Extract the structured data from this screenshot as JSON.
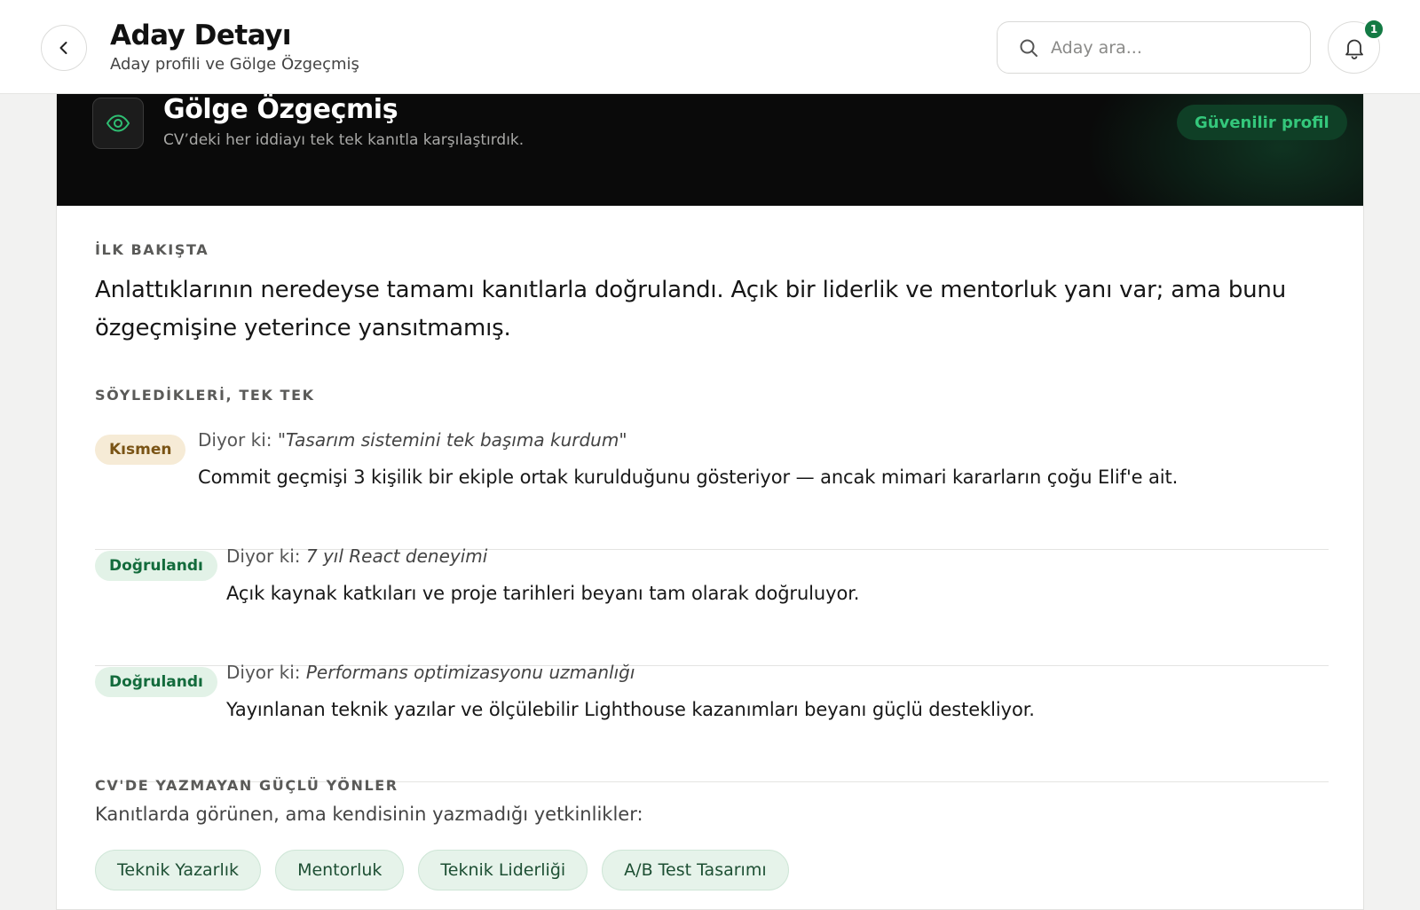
{
  "header": {
    "title": "Aday Detayı",
    "subtitle": "Aday profili ve Gölge Özgeçmiş",
    "search_placeholder": "Aday ara...",
    "notification_count": "1"
  },
  "shadow_cv": {
    "title": "Gölge Özgeçmiş",
    "subtitle": "CV’deki her iddiayı tek tek kanıtla karşılaştırdık.",
    "trust_label": "Güvenilir profil"
  },
  "overview": {
    "label": "İLK BAKIŞTA",
    "text": "Anlattıklarının neredeyse tamamı kanıtlarla doğrulandı. Açık bir liderlik ve mentorluk yanı var; ama bunu özgeçmişine yeterince yansıtmamış."
  },
  "claims": {
    "label": "SÖYLEDİKLERİ, TEK TEK",
    "items": [
      {
        "status": "Kısmen",
        "prefix": "Diyor ki:",
        "quote": "\"Tasarım sistemini tek başıma kurdum\"",
        "detail": "Commit geçmişi 3 kişilik bir ekiple ortak kurulduğunu gösteriyor — ancak mimari kararların çoğu Elif'e ait."
      },
      {
        "status": "Doğrulandı",
        "prefix": "Diyor ki:",
        "quote": "7 yıl React deneyimi",
        "detail": "Açık kaynak katkıları ve proje tarihleri beyanı tam olarak doğruluyor."
      },
      {
        "status": "Doğrulandı",
        "prefix": "Diyor ki:",
        "quote": "Performans optimizasyonu uzmanlığı",
        "detail": "Yayınlanan teknik yazılar ve ölçülebilir Lighthouse kazanımları beyanı güçlü destekliyor."
      }
    ]
  },
  "hidden_strengths": {
    "label": "CV'DE YAZMAYAN GÜÇLÜ YÖNLER",
    "intro": "Kanıtlarda görünen, ama kendisinin yazmadığı yetkinlikler:",
    "chips": [
      "Teknik Yazarlık",
      "Mentorluk",
      "Teknik Liderliği",
      "A/B Test Tasarımı"
    ]
  },
  "colors": {
    "accent_green": "#137a44",
    "partial_bg": "#f6ebd6",
    "verified_bg": "#e2f2e7"
  },
  "icons": [
    "chevron-left-icon",
    "search-icon",
    "bell-icon",
    "eye-icon"
  ]
}
